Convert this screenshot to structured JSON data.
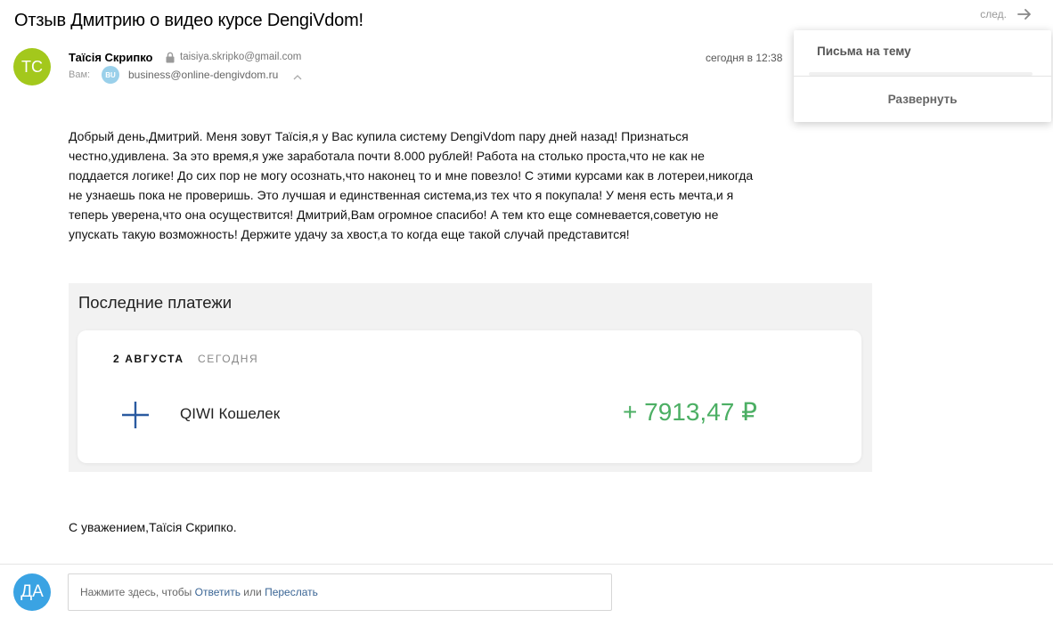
{
  "message": {
    "subject": "Отзыв Дмитрию о видео курсе DengiVdom!",
    "sender": {
      "initials": "TC",
      "name": "Таїсія Скрипко",
      "email": "taisiya.skripko@gmail.com",
      "avatar_color": "#a3c81c"
    },
    "date": "сегодня в 12:38",
    "to_label": "Вам:",
    "recipient": {
      "badge": "BU",
      "email": "business@online-dengivdom.ru"
    },
    "body": "Добрый день,Дмитрий. Меня зовут Таїсія,я у Вас купила систему DengiVdom пару дней назад! Признаться честно,удивлена. За это время,я уже заработала почти 8.000  рублей! Работа на столько проста,что не как не поддается логике! До сих пор не могу осознать,что наконец то и мне повезло! С этими курсами как в лотереи,никогда не узнаешь пока не проверишь. Это лучшая и единственная система,из тех что я покупала! У меня есть мечта,и я теперь уверена,что она осуществится! Дмитрий,Вам огромное спасибо! А тем кто еще сомневается,советую не упускать такую возможность! Держите удачу за хвост,а то когда еще такой случай представится!",
    "signature": "С уважением,Таїсія Скрипко."
  },
  "payments": {
    "title": "Последние платежи",
    "date": "2 АВГУСТА",
    "day": "СЕГОДНЯ",
    "item": {
      "name": "QIWI Кошелек",
      "amount": "+ 7913,47 ₽",
      "amount_color": "#4caf64"
    }
  },
  "nav": {
    "next_label": "след."
  },
  "thread_panel": {
    "title": "Письма на тему",
    "expand_label": "Развернуть"
  },
  "reply": {
    "avatar_initials": "ДА",
    "prompt": "Нажмите здесь, чтобы",
    "reply_link": "Ответить",
    "or": "или",
    "forward_link": "Переслать"
  },
  "icons": {
    "next": "arrow-right-icon",
    "lock": "lock-icon",
    "expand": "chevron-down-icon",
    "payment": "plus-icon"
  }
}
